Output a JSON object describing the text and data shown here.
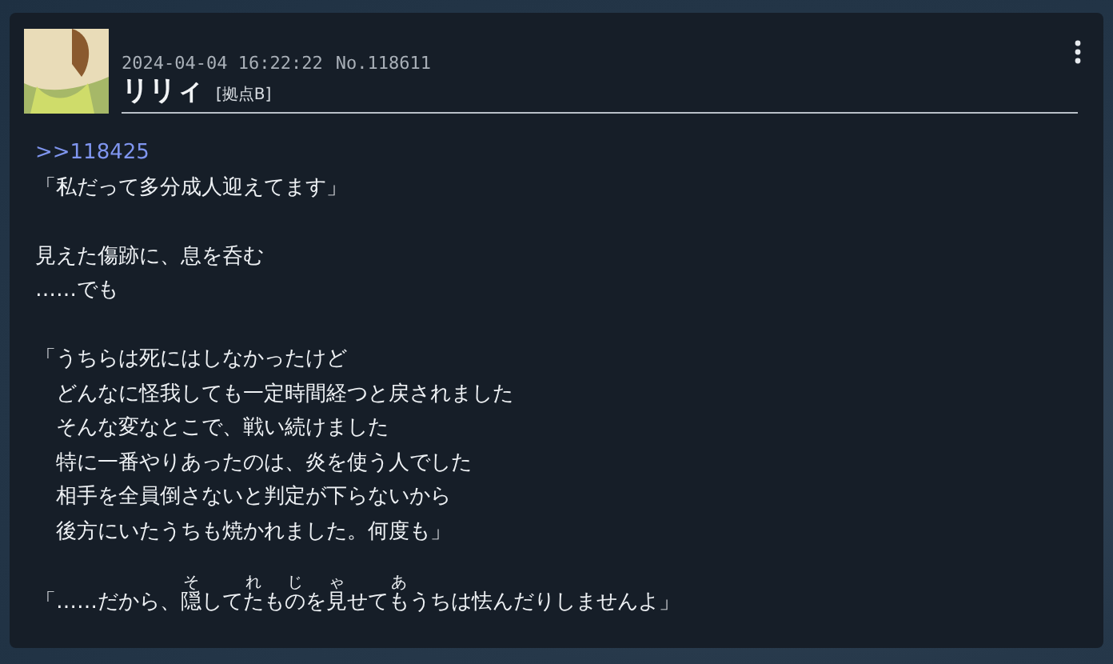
{
  "post": {
    "date": "2024-04-04 16:22:22",
    "number": "No.118611",
    "name": "リリィ",
    "tag": "[拠点B]",
    "reply_link": ">>118425",
    "paragraphs": [
      {
        "lines": [
          {
            "kind": "plain",
            "text": "「私だって多分成人迎えてます」"
          }
        ]
      },
      {
        "lines": [
          {
            "kind": "plain",
            "text": "見えた傷跡に、息を呑む"
          },
          {
            "kind": "plain",
            "text": "……でも"
          }
        ]
      },
      {
        "lines": [
          {
            "kind": "plain",
            "text": "「うちらは死にはしなかったけど"
          },
          {
            "kind": "plain",
            "text": "　どんなに怪我しても一定時間経つと戻されました"
          },
          {
            "kind": "plain",
            "text": "　そんな変なとこで、戦い続けました"
          },
          {
            "kind": "plain",
            "text": "　特に一番やりあったのは、炎を使う人でした"
          },
          {
            "kind": "plain",
            "text": "　相手を全員倒さないと判定が下らないから"
          },
          {
            "kind": "plain",
            "text": "　後方にいたうちも焼かれました。何度も」"
          }
        ]
      },
      {
        "lines": [
          {
            "kind": "ruby",
            "segments": [
              {
                "text": "「……だから、"
              },
              {
                "text": "隠",
                "ruby": "そ"
              },
              {
                "text": "して"
              },
              {
                "text": "た",
                "ruby": "れ"
              },
              {
                "text": "も"
              },
              {
                "text": "の",
                "ruby": "じ"
              },
              {
                "text": "を"
              },
              {
                "text": "見",
                "ruby": "ゃ"
              },
              {
                "text": "せて"
              },
              {
                "text": "も",
                "ruby": "あ"
              },
              {
                "text": "うちは怯んだりしませんよ」"
              }
            ]
          }
        ]
      }
    ]
  }
}
